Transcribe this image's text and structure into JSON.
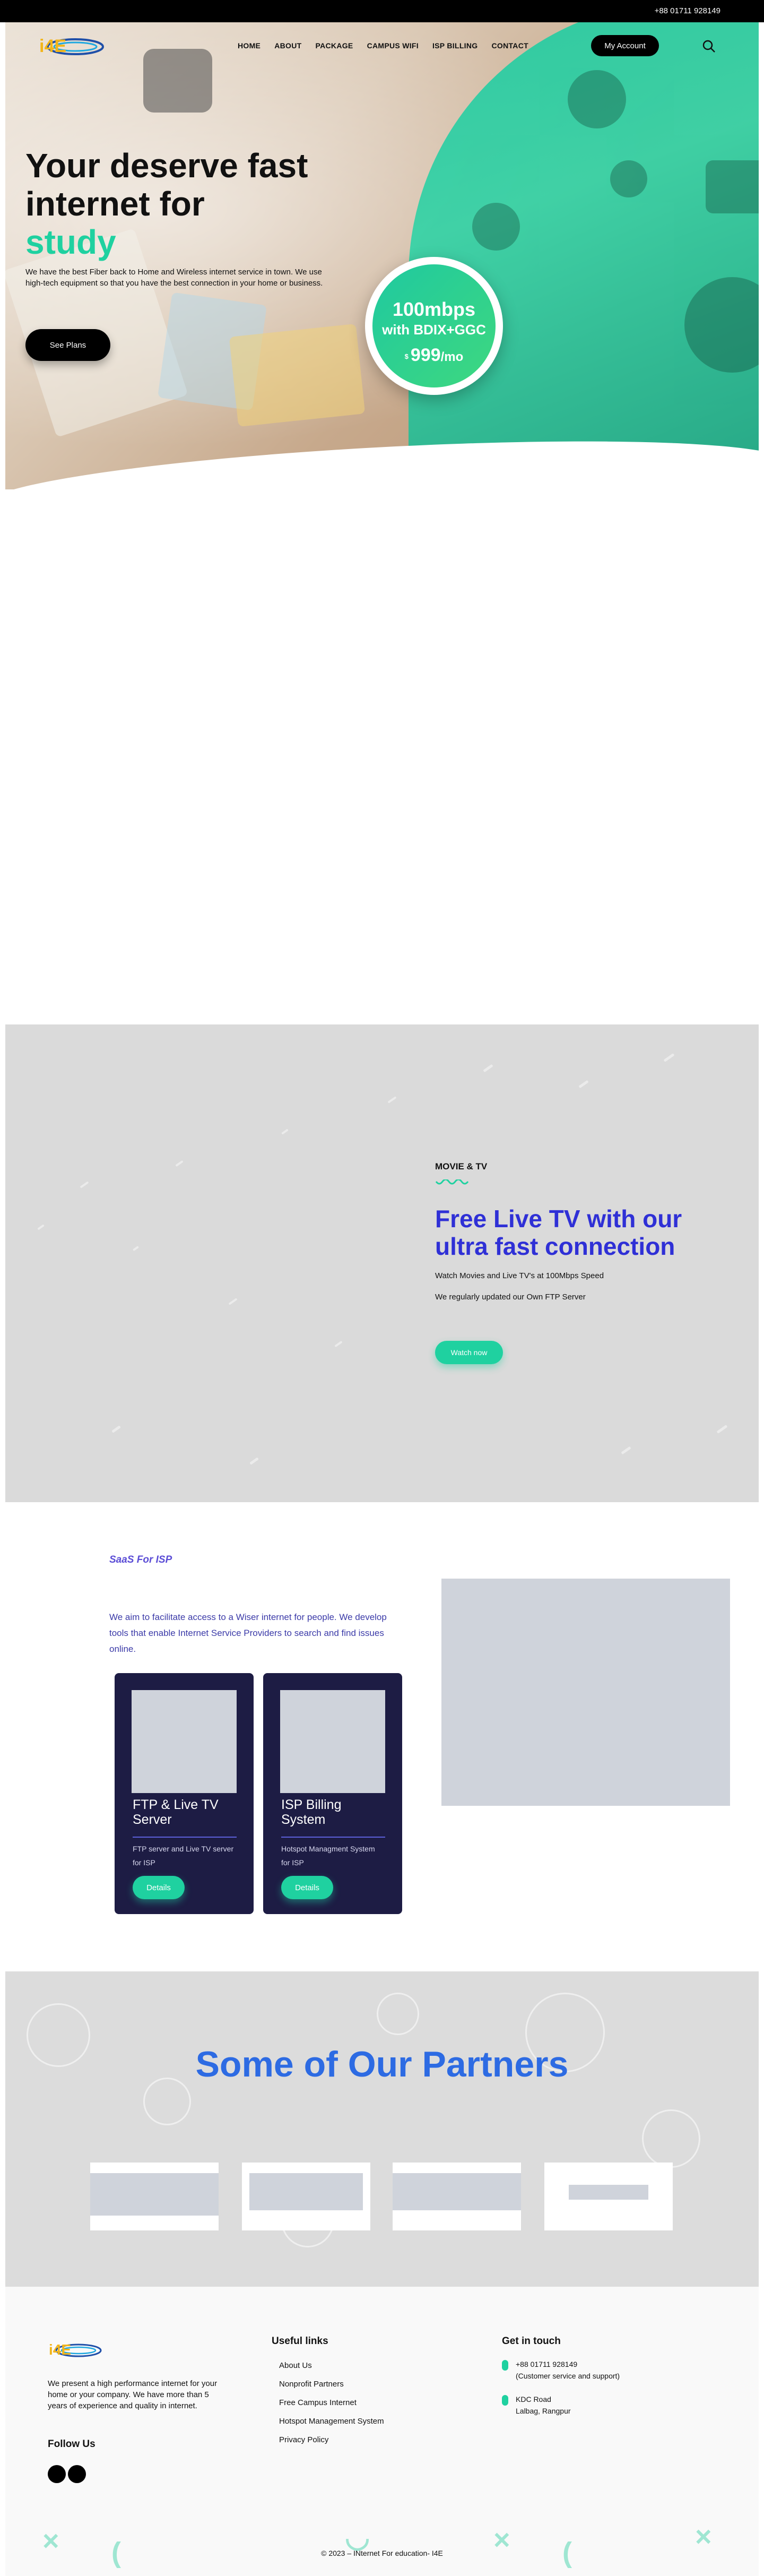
{
  "topbar": {
    "phone": "+88 01711 928149"
  },
  "nav": {
    "logo": "i4E",
    "items": [
      "HOME",
      "ABOUT",
      "PACKAGE",
      "CAMPUS WIFI",
      "ISP BILLING",
      "CONTACT"
    ],
    "account_label": "My Account"
  },
  "hero": {
    "title_line1": "Your deserve fast",
    "title_line2": "internet for",
    "title_accent": "study",
    "description": "We have the best Fiber back to Home and Wireless internet service in town. We use high-tech equipment so that you have the best connection in your home or business.",
    "cta_label": "See Plans",
    "price": {
      "speed": "100mbps",
      "sub": "with BDIX+GGC",
      "currency": "$",
      "amount": "999",
      "period": "/mo"
    }
  },
  "tv": {
    "eyebrow": "MOVIE & TV",
    "title": "Free Live TV with our ultra fast connection",
    "line1": "Watch Movies and Live TV's at 100Mbps Speed",
    "line2": "We regularly updated our Own FTP Server",
    "cta_label": "Watch now"
  },
  "saas": {
    "eyebrow": "SaaS For ISP",
    "description": "We aim to facilitate access to a Wiser internet for people. We develop tools that enable Internet Service Providers to search and find issues online.",
    "cards": [
      {
        "title": "FTP & Live TV Server",
        "desc": "FTP server and Live TV server for ISP",
        "cta": "Details"
      },
      {
        "title": "ISP Billing System",
        "desc": "Hotspot Managment System for ISP",
        "cta": "Details"
      }
    ]
  },
  "partners": {
    "title": "Some of Our Partners"
  },
  "footer": {
    "logo": "i4E",
    "description": "We present a high performance internet for your home or your company. We have more than 5 years of experience and quality in internet.",
    "follow_title": "Follow Us",
    "links_title": "Useful links",
    "links": [
      "About Us",
      "Nonprofit Partners",
      "Free Campus Internet",
      "Hotspot Management System",
      "Privacy Policy"
    ],
    "contact_title": "Get in touch",
    "phone": "+88 01711 928149",
    "phone_note": "(Customer service and support)",
    "address_line1": "KDC Road",
    "address_line2": "Lalbag, Rangpur",
    "copyright": "© 2023 – INternet For education- I4E"
  },
  "colors": {
    "accent": "#1fd1a0",
    "tv_title": "#2f30d6",
    "saas_text": "#3b3aa8",
    "card_bg": "#1d1c44",
    "partners_title": "#2d6be3"
  }
}
